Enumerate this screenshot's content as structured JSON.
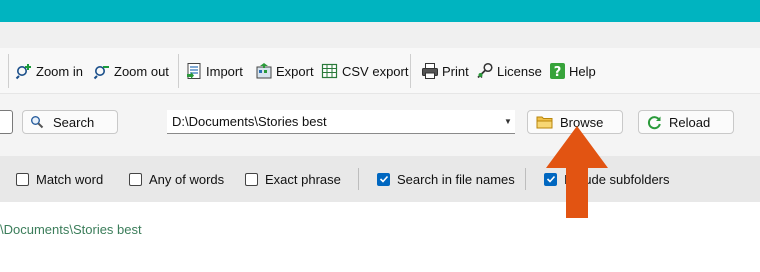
{
  "colors": {
    "titlebar": "#00b4c0",
    "arrow": "#e25412",
    "checkbox_on": "#0067c0",
    "result_path": "#3b7d5a"
  },
  "toolbar": {
    "zoom_in": "Zoom in",
    "zoom_out": "Zoom out",
    "import": "Import",
    "export": "Export",
    "csv_export": "CSV export",
    "print": "Print",
    "license": "License",
    "help": "Help"
  },
  "search_row": {
    "search_label": "Search",
    "path_value": "D:\\Documents\\Stories best",
    "browse_label": "Browse",
    "reload_label": "Reload"
  },
  "options": {
    "match_word": {
      "label": "Match word",
      "checked": false
    },
    "any_of_words": {
      "label": "Any of words",
      "checked": false
    },
    "exact_phrase": {
      "label": "Exact phrase",
      "checked": false
    },
    "search_in_file_names": {
      "label": "Search in file names",
      "checked": true
    },
    "include_subfolders": {
      "label": "Include subfolders",
      "checked": true
    }
  },
  "results": {
    "path": "\\Documents\\Stories best"
  }
}
